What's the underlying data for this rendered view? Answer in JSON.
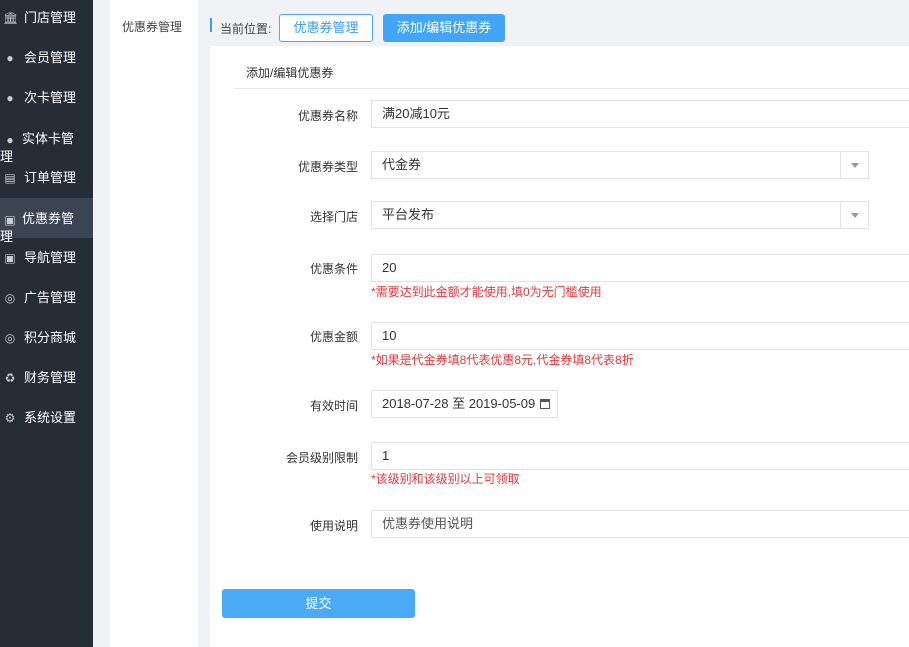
{
  "sidebar": {
    "items": [
      {
        "label": "门店管理",
        "icon": "bank-icon"
      },
      {
        "label": "会员管理",
        "icon": "user-icon"
      },
      {
        "label": "次卡管理",
        "icon": "user-icon"
      },
      {
        "label": "实体卡管理",
        "icon": "user-icon"
      },
      {
        "label": "订单管理",
        "icon": "document-icon"
      },
      {
        "label": "优惠券管理",
        "icon": "money-icon",
        "active": true
      },
      {
        "label": "导航管理",
        "icon": "money-icon"
      },
      {
        "label": "广告管理",
        "icon": "lifebuoy-icon"
      },
      {
        "label": "积分商城",
        "icon": "lifebuoy-icon"
      },
      {
        "label": "财务管理",
        "icon": "recycle-icon"
      },
      {
        "label": "系统设置",
        "icon": "gear-icon"
      }
    ]
  },
  "subnav": {
    "item": "优惠券管理"
  },
  "breadcrumb": {
    "label": "当前位置:",
    "link": "优惠券管理",
    "current": "添加/编辑优惠券"
  },
  "panel": {
    "title": "添加/编辑优惠券"
  },
  "form": {
    "name": {
      "label": "优惠券名称",
      "value": "满20减10元"
    },
    "type": {
      "label": "优惠券类型",
      "value": "代金券"
    },
    "store": {
      "label": "选择门店",
      "value": "平台发布"
    },
    "condition": {
      "label": "优惠条件",
      "value": "20",
      "hint": "*需要达到此金额才能使用,填0为无门槛使用"
    },
    "amount": {
      "label": "优惠金额",
      "value": "10",
      "hint": "*如果是代金券填8代表优惠8元,代金券填8代表8折"
    },
    "validity": {
      "label": "有效时间",
      "value": "2018-07-28 至 2019-05-09"
    },
    "level": {
      "label": "会员级别限制",
      "value": "1",
      "hint": "*该级别和该级别以上可领取"
    },
    "desc": {
      "label": "使用说明",
      "placeholder": "优惠券使用说明"
    },
    "submit": "提交"
  },
  "colors": {
    "sidebar_bg": "#272d37",
    "accent": "#42a5f7",
    "hint": "#e4393c"
  }
}
